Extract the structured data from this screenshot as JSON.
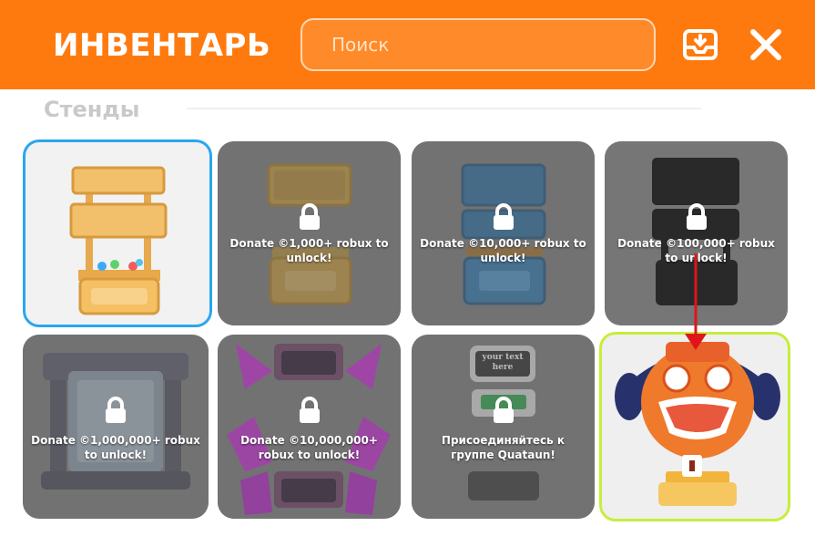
{
  "header": {
    "title": "ИНВЕНТАРЬ",
    "search_placeholder": "Поиск",
    "icons": [
      "inbox-download-icon",
      "close-icon"
    ]
  },
  "section": {
    "title": "Стенды"
  },
  "stands": [
    {
      "name": "Wooden stand",
      "locked": false,
      "selected": true
    },
    {
      "name": "Gold stand",
      "locked": true,
      "requirement": "Donate ©1,000+ robux to unlock!"
    },
    {
      "name": "Blue stand",
      "locked": true,
      "requirement": "Donate ©10,000+ robux to unlock!"
    },
    {
      "name": "Black stand",
      "locked": true,
      "requirement": "Donate ©100,000+ robux to unlock!"
    },
    {
      "name": "Stone stand",
      "locked": true,
      "requirement": "Donate ©1,000,000+ robux to unlock!"
    },
    {
      "name": "Purple crystal stand",
      "locked": true,
      "requirement": "Donate ©10,000,000+ robux to unlock!"
    },
    {
      "name": "Screen stand",
      "locked": true,
      "requirement": "Присоединяйтесь к группе Quataun!",
      "screen_text": "your text here"
    },
    {
      "name": "Headphones mascot stand",
      "locked": false,
      "featured": true
    }
  ],
  "colors": {
    "header_bg": "#ff7a0e",
    "selected_border": "#2aa6ee",
    "featured_border": "#c6ee3a",
    "arrow": "#e0151b"
  }
}
